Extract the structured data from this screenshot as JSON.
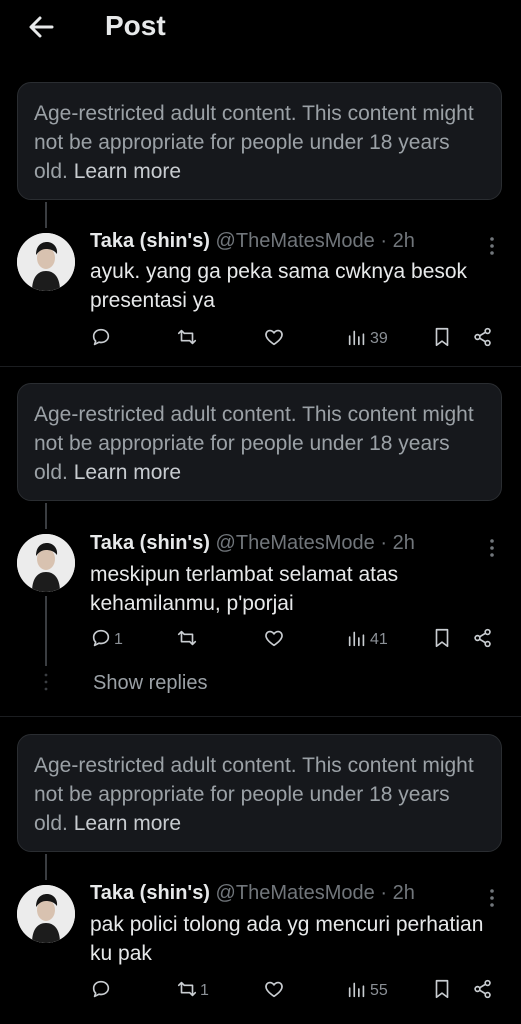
{
  "header": {
    "title": "Post"
  },
  "warning": {
    "text": "Age-restricted adult content. This content might not be appropriate for people under 18 years old.",
    "learn_more": "Learn more"
  },
  "posts": [
    {
      "name": "Taka (shin's)",
      "handle": "@TheMatesMode · 2h",
      "text": "ayuk. yang ga peka sama cwknya besok presentasi ya",
      "replies": "",
      "reposts": "",
      "views": "39"
    },
    {
      "name": "Taka (shin's)",
      "handle": "@TheMatesMode · 2h",
      "text": "meskipun terlambat selamat atas kehamilanmu, p'porjai",
      "replies": "1",
      "reposts": "",
      "views": "41"
    },
    {
      "name": "Taka (shin's)",
      "handle": "@TheMatesMode · 2h",
      "text": "pak polici tolong ada yg mencuri perhatian ku pak",
      "replies": "",
      "reposts": "1",
      "views": "55"
    }
  ],
  "show_replies": "Show replies",
  "icons": [
    "back-arrow-icon",
    "more-vertical-icon",
    "reply-icon",
    "repost-icon",
    "like-icon",
    "views-icon",
    "bookmark-icon",
    "share-icon"
  ]
}
